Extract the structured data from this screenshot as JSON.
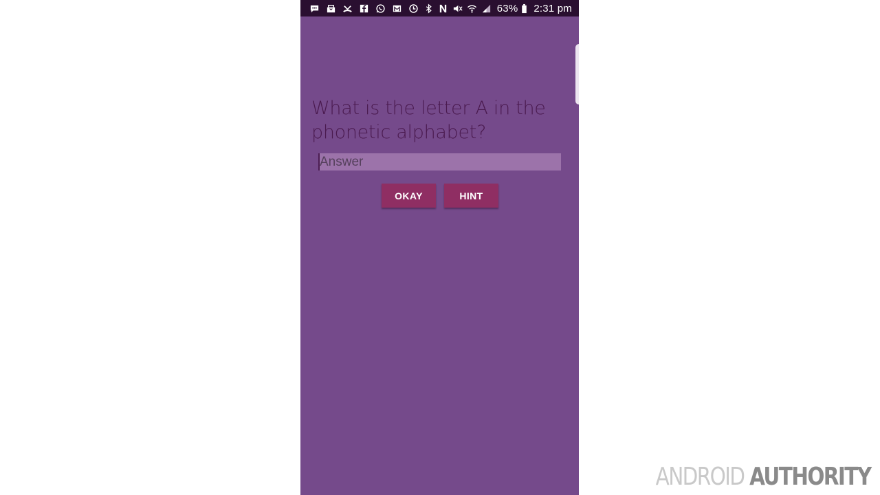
{
  "status_bar": {
    "notification_icons": [
      "messenger-icon",
      "mail-icon",
      "missed-call-icon",
      "facebook-icon",
      "whatsapp-icon",
      "gmail-icon",
      "sync-icon"
    ],
    "system_icons": [
      "bluetooth-icon",
      "nfc-icon",
      "mute-icon",
      "wifi-icon",
      "signal-icon"
    ],
    "battery_percent": "63%",
    "time": "2:31 pm"
  },
  "quiz": {
    "question": "What is the letter A in the phonetic alphabet?",
    "answer_value": "",
    "answer_placeholder": "Answer",
    "okay_label": "OKAY",
    "hint_label": "HINT"
  },
  "watermark": {
    "part1": "ANDROID",
    "part2": "AUTHORITY"
  },
  "colors": {
    "background": "#754a8b",
    "status_bar": "#2a0f30",
    "button": "#8f2e63",
    "input_fill": "#9c73aa",
    "question_text": "#4a1a4f"
  }
}
